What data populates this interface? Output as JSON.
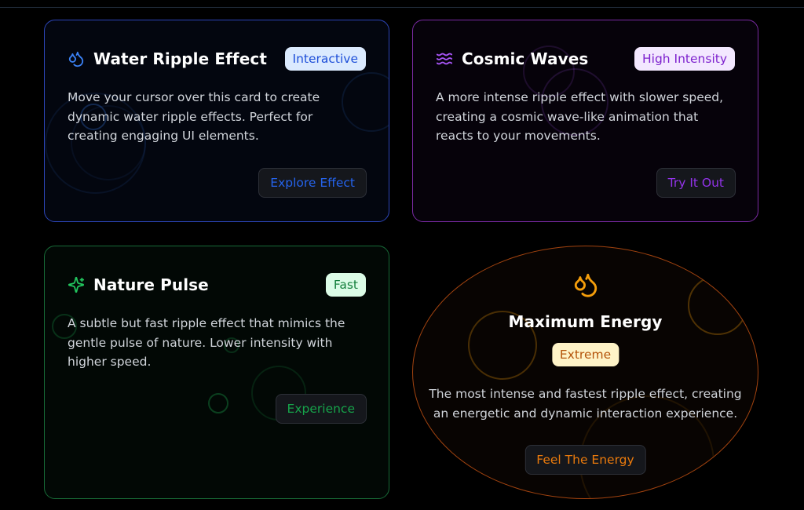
{
  "cards": [
    {
      "icon": "droplet-icon",
      "title": "Water Ripple Effect",
      "badge": "Interactive",
      "description": "Move your cursor over this card to create dynamic water ripple effects. Perfect for creating engaging UI elements.",
      "button": "Explore Effect",
      "accent": "#3b82f6"
    },
    {
      "icon": "waves-icon",
      "title": "Cosmic Waves",
      "badge": "High Intensity",
      "description": "A more intense ripple effect with slower speed, creating a cosmic wave-like animation that reacts to your movements.",
      "button": "Try It Out",
      "accent": "#a855f7"
    },
    {
      "icon": "sparkles-icon",
      "title": "Nature Pulse",
      "badge": "Fast",
      "description": "A subtle but fast ripple effect that mimics the gentle pulse of nature. Lower intensity with higher speed.",
      "button": "Experience",
      "accent": "#22c55e"
    },
    {
      "icon": "droplets-icon",
      "title": "Maximum Energy",
      "badge": "Extreme",
      "description": "The most intense and fastest ripple effect, creating an energetic and dynamic interaction experience.",
      "button": "Feel The Energy",
      "accent": "#f59e0b"
    }
  ]
}
